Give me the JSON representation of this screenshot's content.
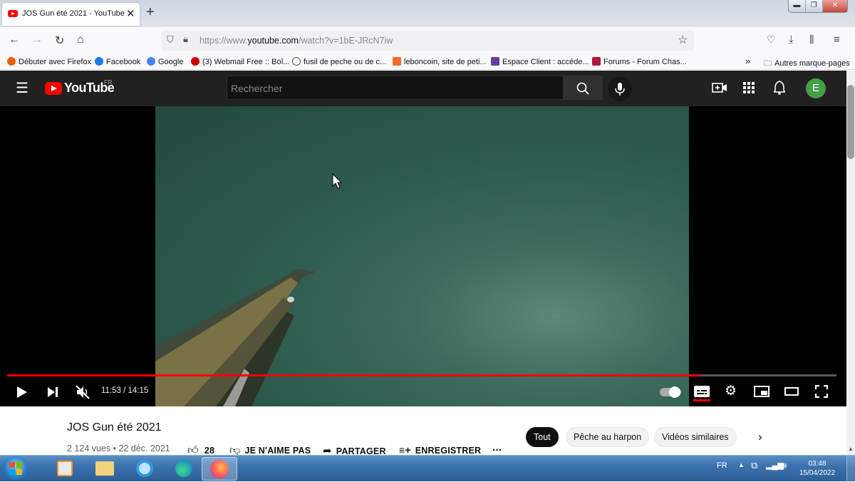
{
  "browser": {
    "tab_title": "JOS Gun été 2021 - YouTube",
    "url_prefix": "https://www.",
    "url_domain": "youtube.com",
    "url_rest": "/watch?v=1bE-JRcN7iw",
    "bookmarks": [
      {
        "label": "Débuter avec Firefox",
        "color": "#e66000"
      },
      {
        "label": "Facebook",
        "color": "#1877f2"
      },
      {
        "label": "Google",
        "color": "#4285f4"
      },
      {
        "label": "(3) Webmail Free :: Boî...",
        "color": "#cc0000"
      },
      {
        "label": "fusil de peche ou de c...",
        "color": "#555555"
      },
      {
        "label": "leboncoin, site de peti...",
        "color": "#f56b2a"
      },
      {
        "label": "Espace Client : accéde...",
        "color": "#6a3ba0"
      },
      {
        "label": "Forums - Forum Chas...",
        "color": "#b0183d"
      }
    ],
    "other_bookmarks": "Autres marque-pages"
  },
  "youtube": {
    "logo_text": "YouTube",
    "region": "FR",
    "search_placeholder": "Rechercher",
    "avatar_letter": "E"
  },
  "player": {
    "current_time": "11:53",
    "duration": "14:15",
    "time_display": "11:53 / 14:15",
    "progress_fraction": 0.836
  },
  "video": {
    "title": "JOS Gun été 2021",
    "stats": "2 124 vues • 22 déc. 2021",
    "likes": "28",
    "dislike_label": "JE N'AIME PAS",
    "share_label": "PARTAGER",
    "save_label": "ENREGISTRER",
    "more_label": "..."
  },
  "chips": [
    "Tout",
    "Pêche au harpon",
    "Vidéos similaires"
  ],
  "taskbar": {
    "lang": "FR",
    "time": "03:48",
    "date": "15/04/2022"
  }
}
